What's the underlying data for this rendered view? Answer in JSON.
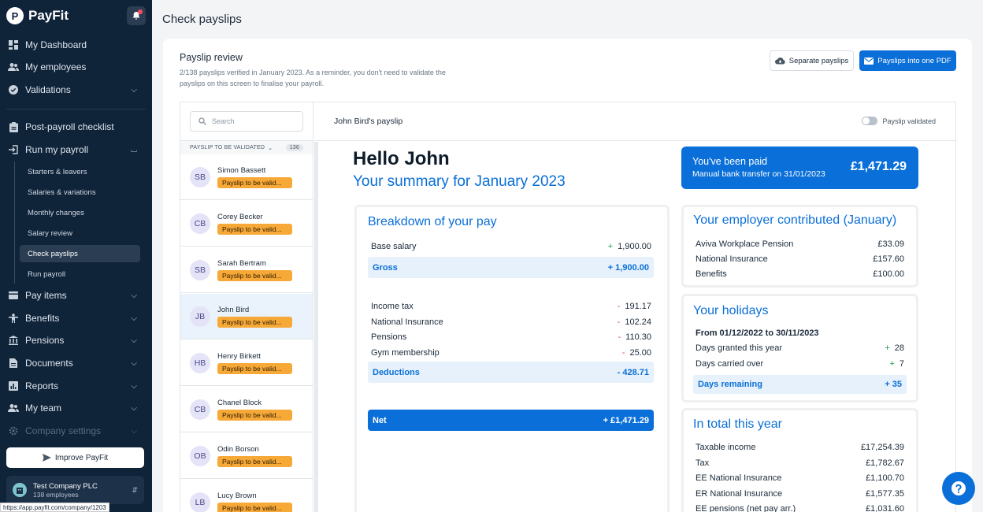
{
  "app": {
    "name": "PayFit"
  },
  "sidebar": {
    "top_items": [
      {
        "label": "My Dashboard"
      },
      {
        "label": "My employees"
      },
      {
        "label": "Validations"
      }
    ],
    "items": [
      {
        "label": "Post-payroll checklist"
      },
      {
        "label": "Run my payroll"
      },
      {
        "label": "Pay items"
      },
      {
        "label": "Benefits"
      },
      {
        "label": "Pensions"
      },
      {
        "label": "Documents"
      },
      {
        "label": "Reports"
      },
      {
        "label": "My team"
      },
      {
        "label": "Company settings"
      }
    ],
    "run_payroll_sub": [
      {
        "label": "Starters & leavers"
      },
      {
        "label": "Salaries & variations"
      },
      {
        "label": "Monthly changes"
      },
      {
        "label": "Salary review"
      },
      {
        "label": "Check payslips"
      },
      {
        "label": "Run payroll"
      }
    ],
    "improve_label": "Improve PayFit",
    "company": {
      "name": "Test Company PLC",
      "employees": "138 employees"
    }
  },
  "status_url": "https://app.payfit.com/company/1203",
  "page": {
    "title": "Check payslips"
  },
  "review": {
    "title": "Payslip review",
    "description": "2/138 payslips verified in January 2023. As a reminder, you don't need to validate the payslips on this screen to finalise your payroll.",
    "separate_label": "Separate payslips",
    "pdf_label": "Payslips into one PDF"
  },
  "list": {
    "search_placeholder": "Search",
    "header": "PAYSLIP TO BE VALIDATED",
    "count": "136",
    "employees": [
      {
        "initials": "SB",
        "name": "Simon Bassett",
        "status": "Payslip to be valid..."
      },
      {
        "initials": "CB",
        "name": "Corey Becker",
        "status": "Payslip to be valid..."
      },
      {
        "initials": "SB",
        "name": "Sarah Bertram",
        "status": "Payslip to be valid..."
      },
      {
        "initials": "JB",
        "name": "John Bird",
        "status": "Payslip to be valid..."
      },
      {
        "initials": "HB",
        "name": "Henry Birkett",
        "status": "Payslip to be valid..."
      },
      {
        "initials": "CB",
        "name": "Chanel Block",
        "status": "Payslip to be valid..."
      },
      {
        "initials": "OB",
        "name": "Odin Borson",
        "status": "Payslip to be valid..."
      },
      {
        "initials": "LB",
        "name": "Lucy Brown",
        "status": "Payslip to be valid..."
      }
    ]
  },
  "payslip": {
    "header_name": "John Bird's payslip",
    "validated_label": "Payslip validated",
    "hello": "Hello John",
    "summary": "Your summary for January 2023",
    "paid": {
      "title": "You've been paid",
      "sub": "Manual bank transfer on 31/01/2023",
      "amount": "£1,471.29"
    },
    "breakdown": {
      "title": "Breakdown of your pay",
      "base": {
        "label": "Base salary",
        "sign": "+",
        "amount": "1,900.00"
      },
      "gross": {
        "label": "Gross",
        "amount": "+ 1,900.00"
      },
      "deductions_items": [
        {
          "label": "Income tax",
          "sign": "-",
          "amount": "191.17"
        },
        {
          "label": "National Insurance",
          "sign": "-",
          "amount": "102.24"
        },
        {
          "label": "Pensions",
          "sign": "-",
          "amount": "110.30"
        },
        {
          "label": "Gym membership",
          "sign": "-",
          "amount": "25.00"
        }
      ],
      "deductions": {
        "label": "Deductions",
        "amount": "- 428.71"
      },
      "net": {
        "label": "Net",
        "amount": "+ £1,471.29"
      }
    },
    "employer": {
      "title": "Your employer contributed (January)",
      "items": [
        {
          "label": "Aviva Workplace Pension",
          "amount": "£33.09"
        },
        {
          "label": "National Insurance",
          "amount": "£157.60"
        },
        {
          "label": "Benefits",
          "amount": "£100.00"
        }
      ]
    },
    "holidays": {
      "title": "Your holidays",
      "period": "From 01/12/2022 to 30/11/2023",
      "items": [
        {
          "label": "Days granted this year",
          "sign": "+",
          "amount": "28"
        },
        {
          "label": "Days carried over",
          "sign": "+",
          "amount": "7"
        }
      ],
      "remaining": {
        "label": "Days remaining",
        "amount": "+ 35"
      }
    },
    "total": {
      "title": "In total this year",
      "items": [
        {
          "label": "Taxable income",
          "amount": "£17,254.39"
        },
        {
          "label": "Tax",
          "amount": "£1,782.67"
        },
        {
          "label": "EE National Insurance",
          "amount": "£1,100.70"
        },
        {
          "label": "ER National Insurance",
          "amount": "£1,577.35"
        },
        {
          "label": "EE pensions (net pay arr.)",
          "amount": "£1,031.60"
        }
      ]
    }
  },
  "colors": {
    "sidebar": "#0f2339",
    "accent": "#0a6fd8",
    "badge": "#f7a938"
  }
}
